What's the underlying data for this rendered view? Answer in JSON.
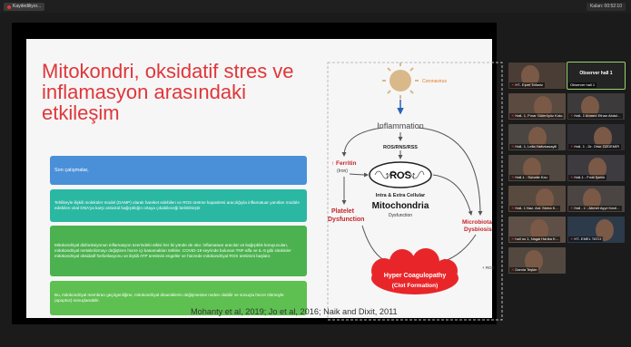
{
  "recording": {
    "label": "Kaydediliyor...",
    "icon": "record-icon"
  },
  "clock": {
    "label": "Kalan: 00:52:10"
  },
  "slide": {
    "title": "Mitokondri, oksidatif stres ve inflamasyon arasındaki etkileşim",
    "boxes": [
      "Son çalışmalar,",
      "Tehlikeyle ilişkili moleküler model (DAMP) olarak hareket edebilen ve ROS üretme kapasitesi aracılığıyla inflamatuar yanıtları modüle edebilen viral DNA'ya karşı antiviral bağışıklığın ortaya çıkabileceği belirtilmiştir",
      "Mitokondriyal disfonksiyonun inflamasyon üzerindeki etkisi her iki yönde de olur. İnflamatuar aracılar ve bağışıklık koruyucuları, mitokondriyal metabolizmayı değiştiren hücre içi basamakları tetikler. COVID-19 seyrinde bulunan TNF-alfa ve IL-6 gibi sitokinler mitokondriyal oksidatif fosforilasyonu ve ilişkili ATP üretimini engeller ve hücrede mitokondriyal ROS üretimini başlatır.",
      "Bu, mitokondriyal membran geçirgenliğine, mitokondriyal dinamiklerin değişmesine neden olabilir ve sonuçta hücre ölümüyle (apoptoz) sonuçlanabilir."
    ],
    "citation": "Mohanty et al, 2019; Jo et al, 2016; Naik and Dixit, 2011",
    "diagram": {
      "coronavirus": "Coronavirus",
      "inflammation": "Inflammation",
      "ros_rns": "ROS/RNS/RSS",
      "ferritin": "↑ Ferritin",
      "iron": "(Iron)",
      "ros": "↑ROS↑",
      "intra": "Intra & Extra Cellular",
      "mito": "Mitochondria",
      "dysfunction": "Dysfunction",
      "platelet1": "Platelet",
      "platelet2": "Dysfunction",
      "micro1": "Microbiota",
      "micro2": "Dysbiosis",
      "hyper": "Hyper Coagulopathy",
      "clot": "(Clot Formation)",
      "plus_ros": "+ ROS"
    }
  },
  "participants": [
    {
      "label": "HT- Eşref Tofaniz",
      "muted": true
    },
    {
      "label": "Observer hall 1",
      "muted": false,
      "no_video": true,
      "name": "Observer hall 1"
    },
    {
      "label": "Hall- 1, Pınar Gülerüyüz Koto...",
      "muted": true
    },
    {
      "label": "Hall- 1 Ahmed Ethan Abdul...",
      "muted": true
    },
    {
      "label": "Hall- 1, Leila Hafızkasayili",
      "muted": true
    },
    {
      "label": "Hall- 1 - Dr. Onur ÖZDEMİR",
      "muted": true
    },
    {
      "label": "Hall-1 - Suhaile Kısı",
      "muted": true
    },
    {
      "label": "Hall-1 - Fırat Şahin",
      "muted": true
    },
    {
      "label": "Hall- 1 Naz. Ast. Sema K...",
      "muted": true
    },
    {
      "label": "Hall - 1 - Ahmet Ayyıl Kecil...",
      "muted": true
    },
    {
      "label": "hall no 1, Nagai Harika K...",
      "muted": true
    },
    {
      "label": "HT- EMEL TATLI",
      "muted": true
    },
    {
      "label": "Damla Teşkin",
      "muted": true
    }
  ],
  "colors": {
    "title": "#e0363a",
    "box_blue": "#4a90d9",
    "box_teal": "#2bb8a3",
    "box_green": "#4cb24f",
    "box_green2": "#5ec050"
  }
}
